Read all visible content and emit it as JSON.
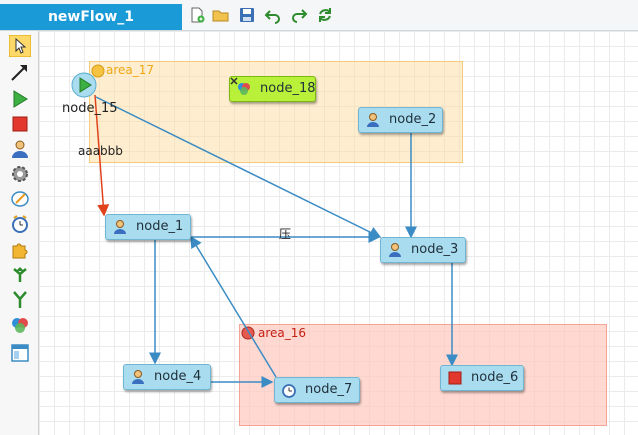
{
  "tab": {
    "title": "newFlow_1"
  },
  "toolbar": {
    "items": [
      "new-file-icon",
      "open-folder-icon",
      "save-icon",
      "undo-icon",
      "redo-icon",
      "refresh-icon"
    ]
  },
  "palette": {
    "items": [
      "select-cursor-icon",
      "connection-arrow-icon",
      "start-node-icon",
      "end-node-icon",
      "user-task-icon",
      "settings-icon",
      "edit-icon",
      "timer-icon",
      "plugin-icon",
      "fork-icon",
      "join-icon",
      "subflow-icon",
      "area-icon"
    ]
  },
  "areas": {
    "area_17": {
      "label": "area_17",
      "color": "#f5c242"
    },
    "area_16": {
      "label": "area_16",
      "color": "#d9534f"
    }
  },
  "nodes": {
    "node_15": {
      "label": "node_15"
    },
    "node_18": {
      "label": "node_18"
    },
    "node_2": {
      "label": "node_2"
    },
    "node_1": {
      "label": "node_1"
    },
    "node_3": {
      "label": "node_3"
    },
    "node_4": {
      "label": "node_4"
    },
    "node_7": {
      "label": "node_7"
    },
    "node_6": {
      "label": "node_6"
    }
  },
  "edges": {
    "edge_15_1": {
      "label": "aaabbb"
    },
    "edge_1_3": {
      "label": "压"
    }
  },
  "colors": {
    "accent": "#1a9ad6",
    "edge": "#3b8cc4",
    "edge_highlight": "#e0421c"
  }
}
